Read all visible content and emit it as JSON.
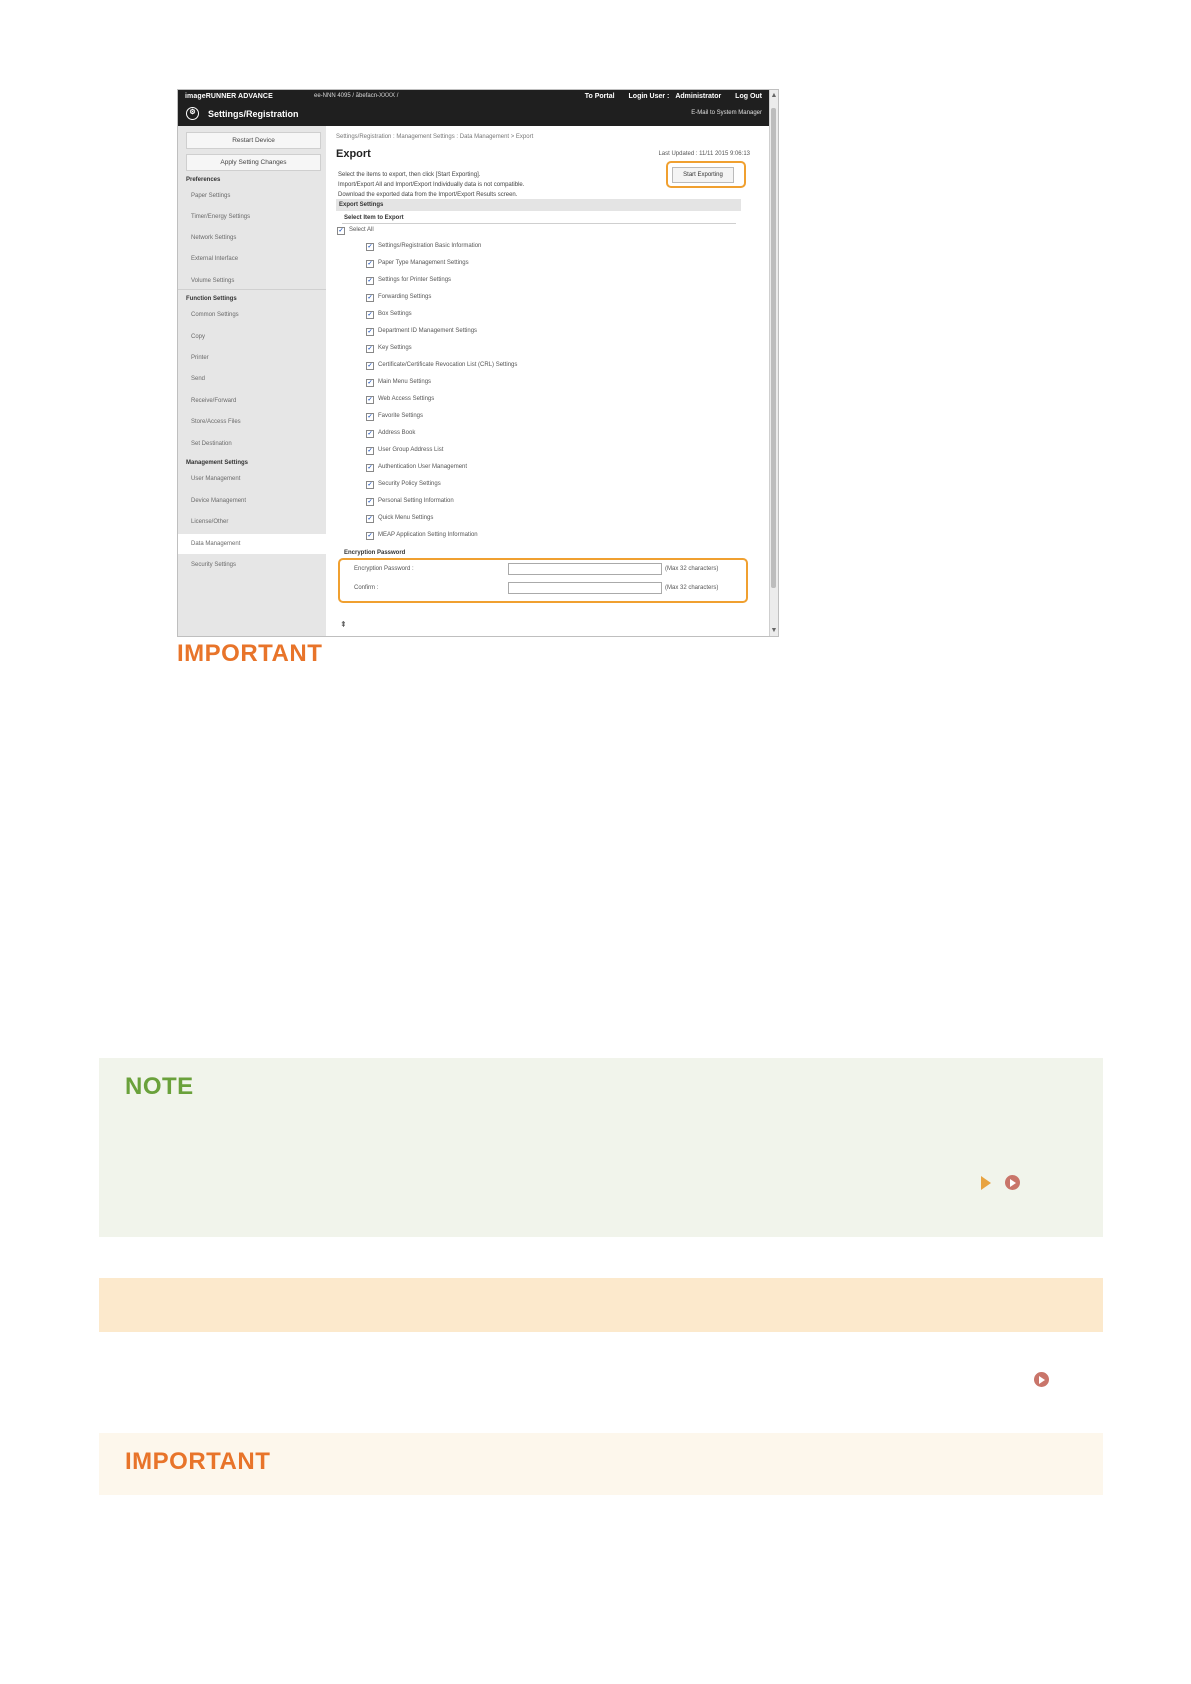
{
  "screenshot": {
    "topbar": {
      "brand": "imageRUNNER ADVANCE",
      "host": "ee-NNN 4095 / ãbefacn-XXXX /",
      "links": [
        "To Portal",
        "Login User :",
        "Administrator",
        "Log Out"
      ],
      "title": "Settings/Registration",
      "mail_link": "E-Mail to System Manager"
    },
    "sidebar": {
      "restart_button": "Restart Device",
      "apply_button": "Apply Setting Changes",
      "groups": [
        {
          "heading": "Preferences",
          "items": [
            "Paper Settings",
            "Timer/Energy Settings",
            "Network Settings",
            "External Interface",
            "Volume Settings"
          ]
        },
        {
          "heading": "Function Settings",
          "items": [
            "Common Settings",
            "Copy",
            "Printer",
            "Send",
            "Receive/Forward",
            "Store/Access Files",
            "Set Destination"
          ]
        },
        {
          "heading": "Management Settings",
          "items": [
            "User Management",
            "Device Management",
            "License/Other",
            "Data Management",
            "Security Settings"
          ]
        }
      ],
      "active_item": "Data Management"
    },
    "main": {
      "breadcrumb": "Settings/Registration : Management Settings : Data Management > Export",
      "title": "Export",
      "last_updated": "Last Updated : 11/11 2015 9:06:13",
      "intro": [
        "Select the items to export, then click [Start Exporting].",
        "Import/Export All and Import/Export Individually data is not compatible.",
        "Download the exported data from the Import/Export Results screen."
      ],
      "start_button": "Start Exporting",
      "export_settings_heading": "Export Settings",
      "select_items_heading": "Select Item to Export",
      "select_all": "Select All",
      "items": [
        "Settings/Registration Basic Information",
        "Paper Type Management Settings",
        "Settings for Printer Settings",
        "Forwarding Settings",
        "Box Settings",
        "Department ID Management Settings",
        "Key Settings",
        "Certificate/Certificate Revocation List (CRL) Settings",
        "Main Menu Settings",
        "Web Access Settings",
        "Favorite Settings",
        "Address Book",
        "User Group Address List",
        "Authentication User Management",
        "Security Policy Settings",
        "Personal Setting Information",
        "Quick Menu Settings",
        "MEAP Application Setting Information"
      ],
      "encryption_heading": "Encryption Password",
      "password_label": "Encryption Password :",
      "confirm_label": "Confirm :",
      "max_hint": "(Max 32 characters)"
    }
  },
  "doc": {
    "important_top": "IMPORTANT",
    "note_title": "NOTE",
    "important_bottom": "IMPORTANT"
  },
  "colors": {
    "important": "#e8742a",
    "note": "#6aa13b",
    "highlight": "#f0a030"
  }
}
